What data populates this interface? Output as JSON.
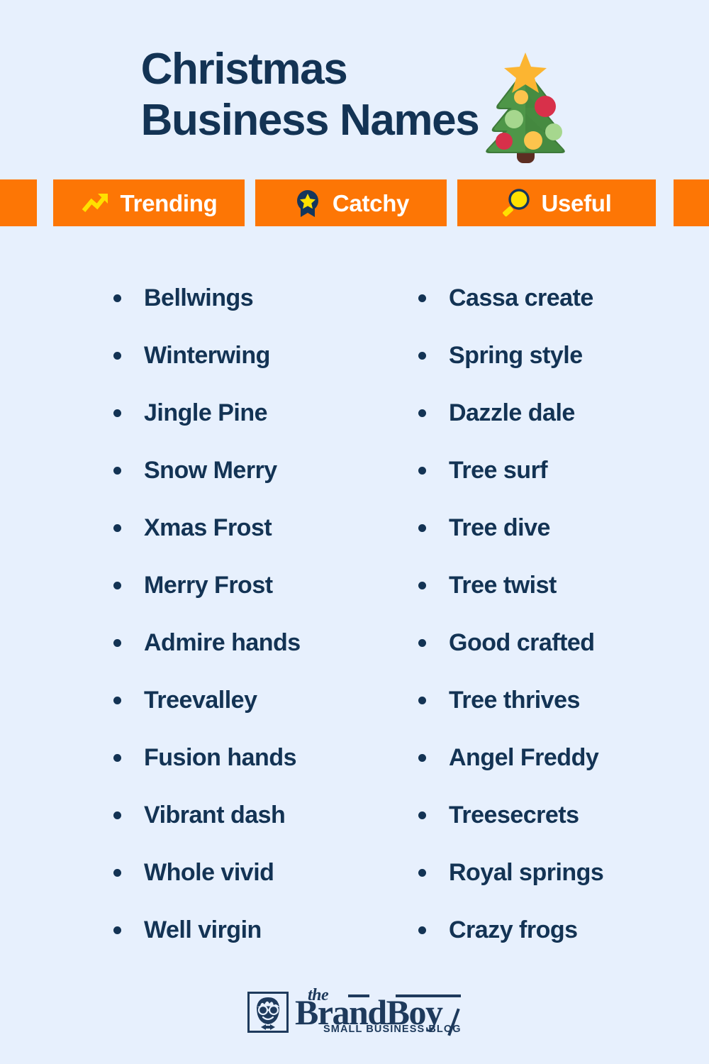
{
  "background_color": "#e7f0fd",
  "accent_color": "#fd7605",
  "text_color": "#133354",
  "header": {
    "title_line_1": "Christmas",
    "title_line_2": "Business Names",
    "decoration_icon": "christmas-tree-icon"
  },
  "badges": [
    {
      "label": "Trending",
      "icon": "trending-up-arrow-icon"
    },
    {
      "label": "Catchy",
      "icon": "award-medal-star-icon"
    },
    {
      "label": "Useful",
      "icon": "magnifying-glass-icon"
    }
  ],
  "lists": {
    "left_column": [
      "Bellwings",
      "Winterwing",
      "Jingle Pine",
      "Snow Merry",
      "Xmas Frost",
      "Merry Frost",
      "Admire hands",
      "Treevalley",
      "Fusion hands",
      "Vibrant dash",
      "Whole vivid",
      "Well virgin"
    ],
    "right_column": [
      "Cassa create",
      "Spring style",
      "Dazzle dale",
      "Tree surf",
      "Tree dive",
      "Tree twist",
      "Good crafted",
      "Tree thrives",
      "Angel Freddy",
      "Treesecrets",
      "Royal springs",
      "Crazy frogs"
    ]
  },
  "footer": {
    "logo_the": "the",
    "logo_brand": "BrandBoy",
    "logo_tagline": "SMALL BUSINESS BLOG",
    "logo_mark_icon": "boy-face-with-glasses-icon"
  }
}
